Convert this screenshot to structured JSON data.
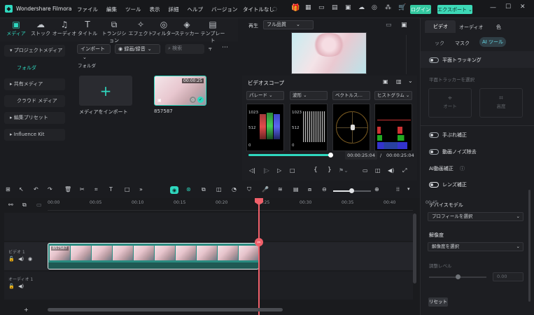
{
  "app": {
    "name": "Wondershare Filmora",
    "menus": [
      "ファイル",
      "編集",
      "ツール",
      "表示",
      "詳細",
      "ヘルプ",
      "バージョン"
    ],
    "project_title": "タイトルなし",
    "login": "ログイン",
    "export": "エクスポート"
  },
  "toolbar": {
    "tools": [
      "メディア",
      "ストック",
      "オーディオ",
      "タイトル",
      "トランジション",
      "エフェクト",
      "フィルター",
      "ステッカー",
      "テンプレート"
    ]
  },
  "sidebar": {
    "items": [
      "プロジェクトメディア",
      "フォルダ",
      "共有メディア",
      "クラウド メディア",
      "編集プリセット",
      "Influence Kit"
    ]
  },
  "media": {
    "import_dropdown": "インポート",
    "record_dropdown": "録画/録音",
    "search_placeholder": "検索",
    "folder_label": "フォルダ",
    "import_tile_label": "メディアをインポート",
    "clip_name": "857587",
    "clip_duration": "00:00:25"
  },
  "preview": {
    "play_label": "再生",
    "quality": "フル品質"
  },
  "scope": {
    "title": "ビデオスコープ",
    "parade": "パレード",
    "waveform": "波形",
    "vectorscope": "ベクトルス…",
    "histogram": "ヒストグラム",
    "ticks": [
      "1023",
      "512",
      "0"
    ],
    "current_time": "00:00:25:04",
    "total_time": "00:00:25:04",
    "progress": 1.0
  },
  "right_panel": {
    "tabs": [
      "ビデオ",
      "オーディオ",
      "色"
    ],
    "subtabs": [
      "ック",
      "マスク",
      "AI ツール"
    ],
    "planar_tracking": "平面トラッキング",
    "select_plane": "平面トラッカーを選択",
    "auto": "オート",
    "advanced": "高度",
    "stabilization": "手ぶれ補正",
    "denoise": "動画ノイズ除去",
    "ai_enhance": "AI動画補正",
    "lens_correction": "レンズ補正",
    "device_model": "デバイスモデル",
    "device_profile": "プロフィールを選択",
    "resolution": "解像度",
    "resolution_select": "解像度を選択",
    "adjust_level": "調整レベル",
    "level_value": "0.00",
    "reset": "リセット"
  },
  "timeline": {
    "ruler": [
      "00:00",
      "00:05",
      "00:10",
      "00:15",
      "00:20",
      "00:25",
      "00:30",
      "00:35",
      "00:40",
      "00:45"
    ],
    "video_track": "ビデオ 1",
    "audio_track": "オーディオ 1",
    "clip_label": "857587"
  },
  "colors": {
    "accent": "#2fd8bf",
    "export_bg": "#3dd9b7",
    "playhead": "#f0606a",
    "login": "#33c9a0"
  }
}
